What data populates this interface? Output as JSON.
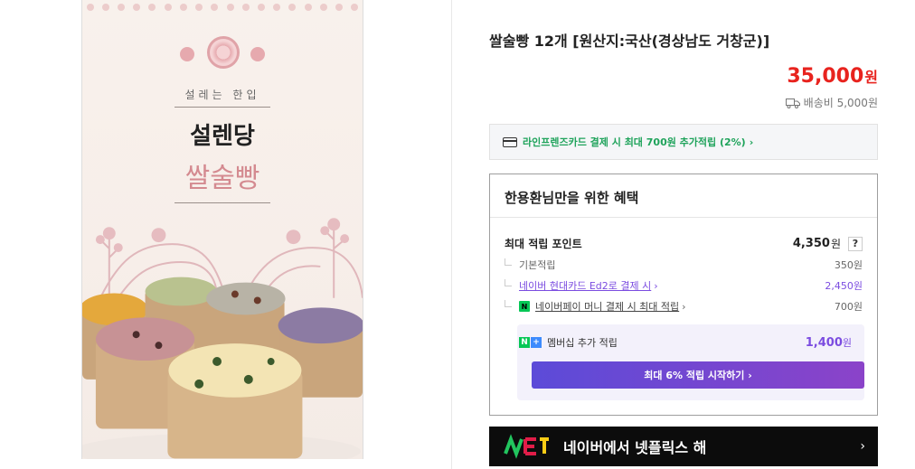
{
  "product": {
    "title": "쌀술빵 12개 [원산지:국산(경상남도 거창군)]",
    "price_value": "35,000",
    "price_unit": "원",
    "shipping": "배송비 5,000원",
    "image": {
      "subtitle": "설레는 한입",
      "brand": "설렌당",
      "name": "쌀술빵"
    }
  },
  "card_benefit": {
    "text": "라인프렌즈카드 결제 시 최대 700원 추가적립 (2%)",
    "chevron": "›"
  },
  "benefits": {
    "header": "한용환님만을 위한 혜택",
    "points_label": "최대 적립 포인트",
    "points_value": "4,350",
    "points_unit": "원",
    "help": "?",
    "rows": [
      {
        "label": "기본적립",
        "value": "350원"
      },
      {
        "label": "네이버 현대카드 Ed2로 결제 시",
        "chevron": "›",
        "value": "2,450원"
      },
      {
        "label": "네이버페이 머니 결제 시 최대 적립",
        "chevron": "›",
        "value": "700원"
      }
    ],
    "membership": {
      "label": "멤버십 추가 적립",
      "value": "1,400",
      "unit": "원",
      "button": "최대 6% 적립 시작하기 ›"
    }
  },
  "banner": {
    "text": "네이버에서 넷플릭스 해",
    "chevron": "›"
  },
  "colors": {
    "price": "#e8231e",
    "card_benefit": "#1fa35b",
    "purple": "#7b4ce0",
    "banner_bg": "#0c0c0c"
  }
}
